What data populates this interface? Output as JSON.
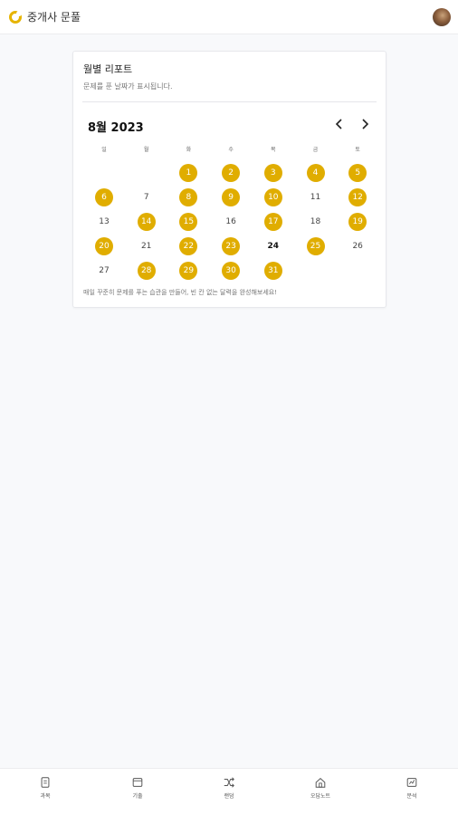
{
  "header": {
    "title": "중개사 문풀"
  },
  "report": {
    "title": "월별 리포트",
    "subtitle": "문제를 푼 날짜가 표시됩니다.",
    "month_label": "8월 2023",
    "footer": "매일 꾸준히 문제를 푸는 습관을 만들어, 빈 칸 없는 달력을 완성해보세요!",
    "weekdays": [
      "일",
      "월",
      "화",
      "수",
      "목",
      "금",
      "토"
    ],
    "first_weekday_index": 2,
    "days_in_month": 31,
    "solved_days": [
      1,
      2,
      3,
      4,
      5,
      6,
      8,
      9,
      10,
      12,
      14,
      15,
      17,
      19,
      20,
      22,
      23,
      25,
      28,
      29,
      30,
      31
    ],
    "today": 24,
    "accent_color": "#e0ad00"
  },
  "bottom_nav": [
    {
      "label": "과목",
      "icon": "subject-icon"
    },
    {
      "label": "기출",
      "icon": "past-exam-icon"
    },
    {
      "label": "랜덤",
      "icon": "shuffle-icon"
    },
    {
      "label": "오답노트",
      "icon": "wrong-note-icon"
    },
    {
      "label": "분석",
      "icon": "analysis-icon"
    }
  ]
}
